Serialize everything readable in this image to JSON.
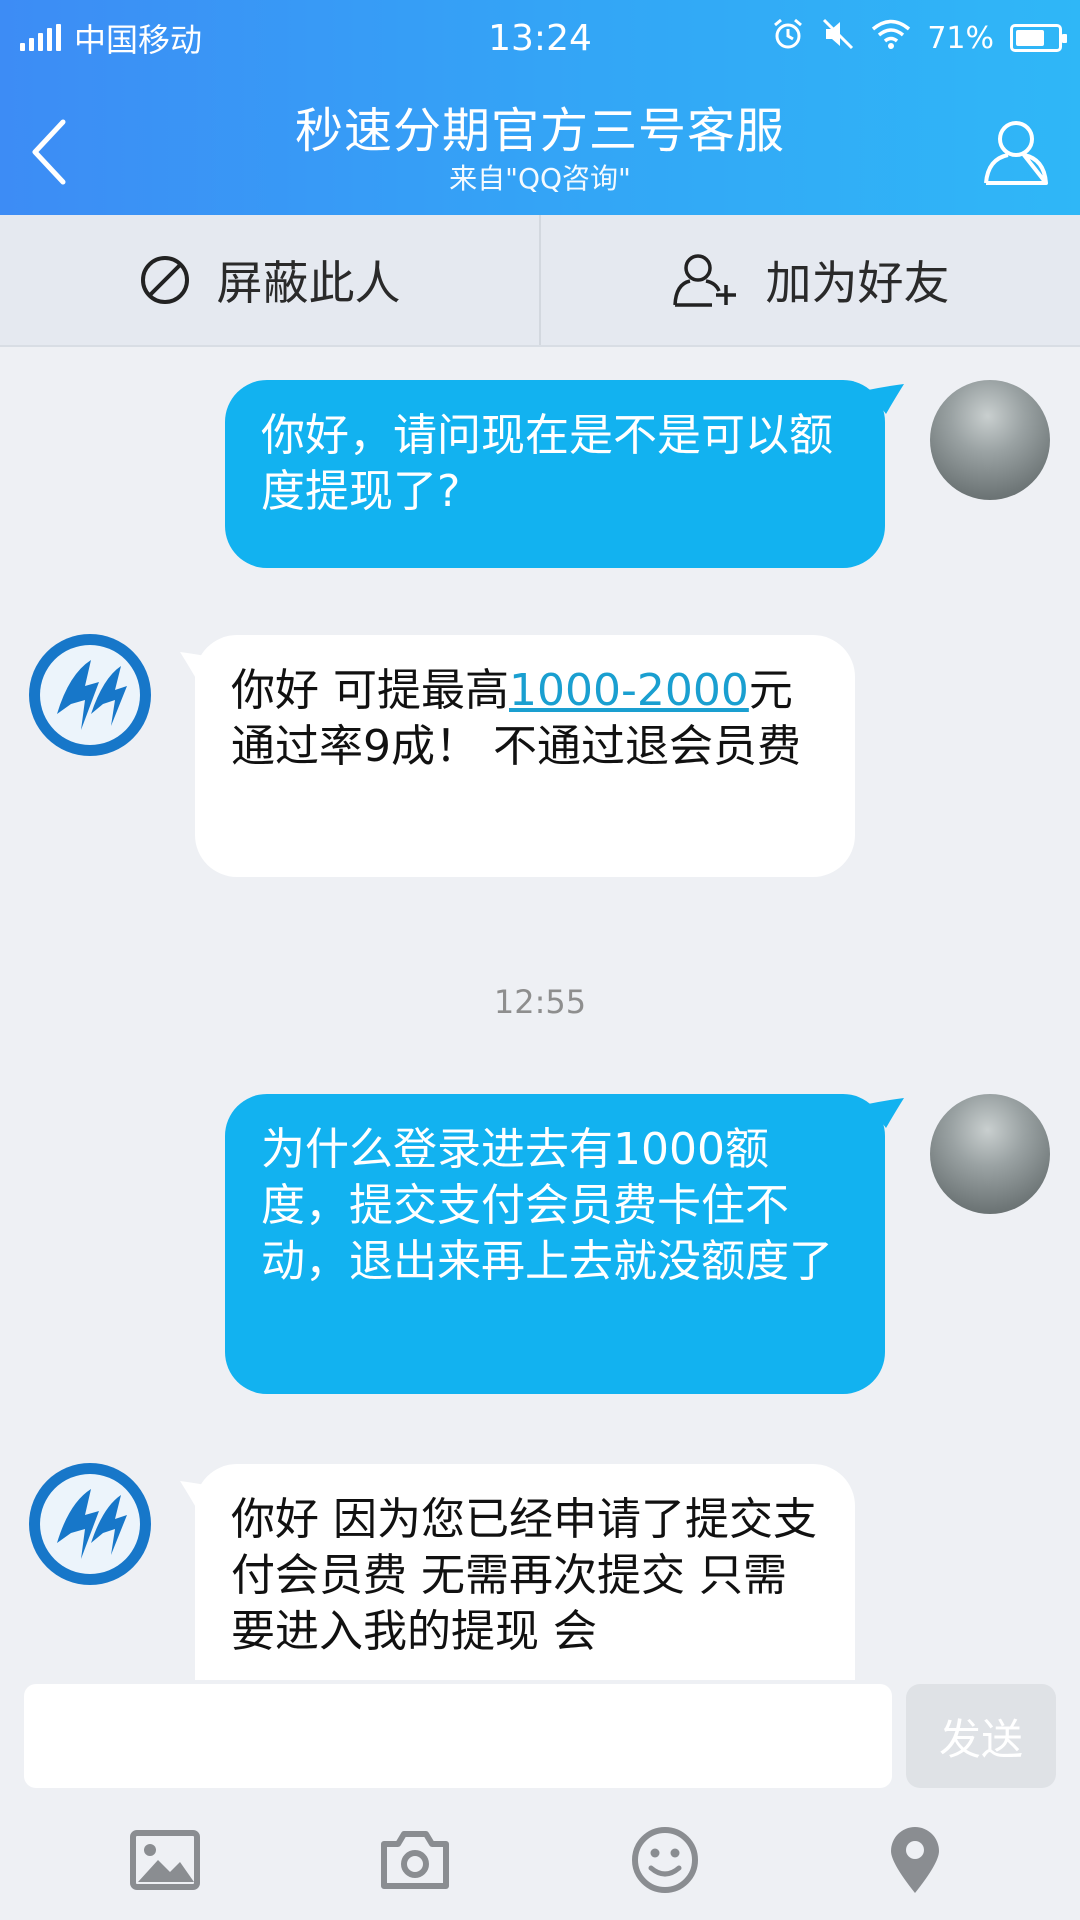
{
  "statusbar": {
    "carrier": "中国移动",
    "time": "13:24",
    "battery": "71%",
    "battery_level": 0.71
  },
  "header": {
    "title": "秒速分期官方三号客服",
    "subtitle": "来自\"QQ咨询\""
  },
  "actions": {
    "block_label": "屏蔽此人",
    "add_friend_label": "加为好友"
  },
  "messages": [
    {
      "from": "me",
      "text": "你好，请问现在是不是可以额度提现了?"
    },
    {
      "from": "service",
      "before_link": "你好  可提最高",
      "link": "1000-2000",
      "after_link": "元通过率9成！  不通过退会员费"
    },
    {
      "time": "12:55"
    },
    {
      "from": "me",
      "text": "为什么登录进去有1000额度，提交支付会员费卡住不动，退出来再上去就没额度了"
    },
    {
      "from": "service",
      "text": "你好  因为您已经申请了提交支付会员费  无需再次提交 只需要进入我的提现  会"
    }
  ],
  "input": {
    "placeholder": "",
    "send_label": "发送"
  },
  "colors": {
    "header_start": "#3d8cf5",
    "header_end": "#2fb7f7",
    "outgoing_bubble": "#12b2f0",
    "incoming_bubble": "#ffffff",
    "bot_avatar": "#1777c9"
  },
  "tool_icons": [
    "image-icon",
    "camera-icon",
    "emoji-icon",
    "location-icon"
  ]
}
